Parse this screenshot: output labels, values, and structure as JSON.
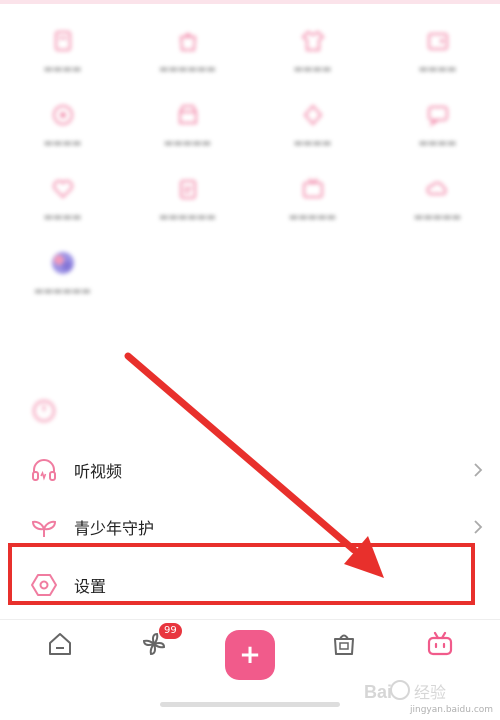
{
  "grid": {
    "rows": [
      [
        {
          "icon": "book-icon"
        },
        {
          "icon": "bag-icon"
        },
        {
          "icon": "shirt-icon"
        },
        {
          "icon": "wallet-icon"
        }
      ],
      [
        {
          "icon": "star-icon"
        },
        {
          "icon": "shop-icon"
        },
        {
          "icon": "diamond-icon"
        },
        {
          "icon": "chat-icon"
        }
      ],
      [
        {
          "icon": "heart-icon"
        },
        {
          "icon": "clipboard-icon"
        },
        {
          "icon": "tv-icon"
        },
        {
          "icon": "cloud-icon"
        }
      ],
      [
        {
          "icon": "app-avatar-icon"
        }
      ]
    ]
  },
  "section": {
    "title": ""
  },
  "list": {
    "items": [
      {
        "label": "",
        "icon": "clock-icon",
        "blurred": true
      },
      {
        "label": "听视频",
        "icon": "headphones-icon"
      },
      {
        "label": "青少年守护",
        "icon": "sprout-icon"
      },
      {
        "label": "设置",
        "icon": "settings-hexagon-icon"
      }
    ]
  },
  "tabbar": {
    "badge": "99",
    "tabs": [
      {
        "label": "",
        "icon": "home-icon"
      },
      {
        "label": "",
        "icon": "pinwheel-icon"
      },
      {
        "label": "",
        "icon": "plus-icon"
      },
      {
        "label": "",
        "icon": "shopping-bag-icon"
      },
      {
        "label": "",
        "icon": "bilibili-tv-icon"
      }
    ]
  },
  "annotation": {
    "color": "#e8302c"
  },
  "watermark": {
    "text": "jingyan.baidu.com"
  },
  "colors": {
    "accent": "#f15b8b",
    "icon_pink": "#f07ca0",
    "badge": "#e8363f"
  }
}
